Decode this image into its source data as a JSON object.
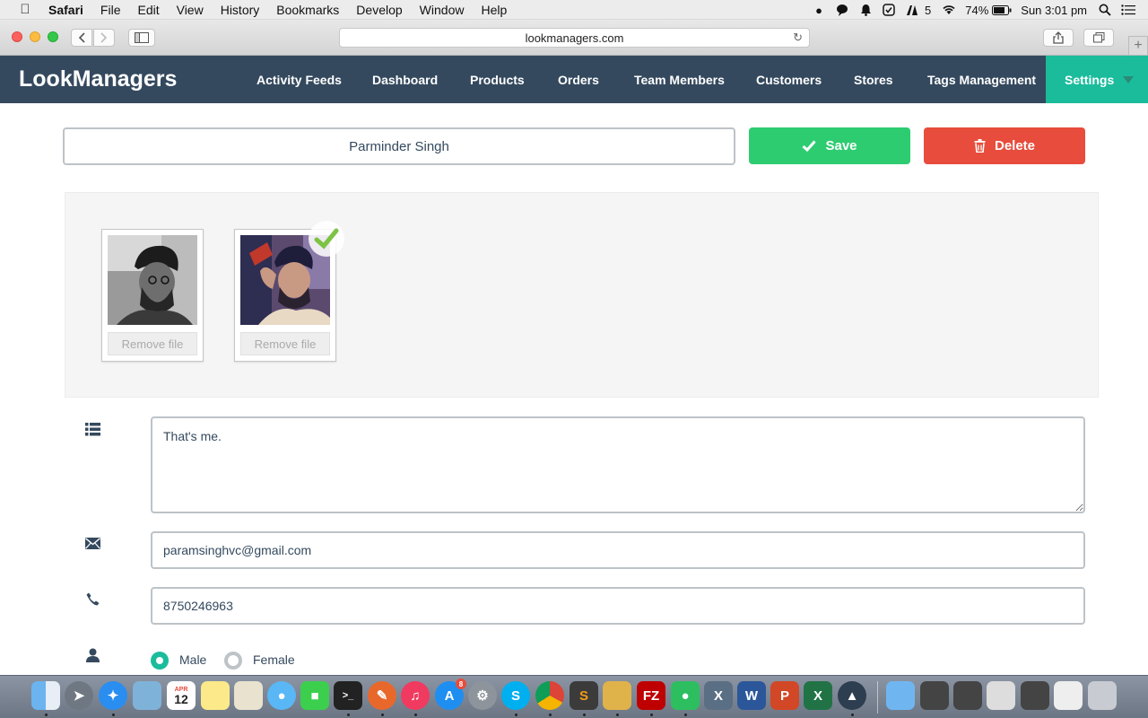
{
  "menubar": {
    "app_name": "Safari",
    "items": [
      "File",
      "Edit",
      "View",
      "History",
      "Bookmarks",
      "Develop",
      "Window",
      "Help"
    ],
    "status": {
      "adobe_count": "5",
      "battery": "74%",
      "clock": "Sun 3:01 pm"
    }
  },
  "browser": {
    "url": "lookmanagers.com"
  },
  "app": {
    "brand": "LookManagers",
    "nav": [
      "Activity Feeds",
      "Dashboard",
      "Products",
      "Orders",
      "Team Members",
      "Customers",
      "Stores",
      "Tags Management"
    ],
    "settings_label": "Settings"
  },
  "profile": {
    "name": "Parminder Singh",
    "save_label": "Save",
    "delete_label": "Delete",
    "files": [
      {
        "remove_label": "Remove file",
        "selected": false
      },
      {
        "remove_label": "Remove file",
        "selected": true
      }
    ],
    "bio": "That's me.",
    "email": "paramsinghvc@gmail.com",
    "phone": "8750246963",
    "gender_options": [
      "Male",
      "Female"
    ],
    "gender_selected": "Male"
  },
  "dock": {
    "calendar_month": "APR",
    "calendar_day": "12",
    "appstore_badge": "8"
  },
  "colors": {
    "nav_bg": "#34495e",
    "accent": "#1abc9c",
    "save": "#2ecc71",
    "delete": "#e74c3c"
  }
}
